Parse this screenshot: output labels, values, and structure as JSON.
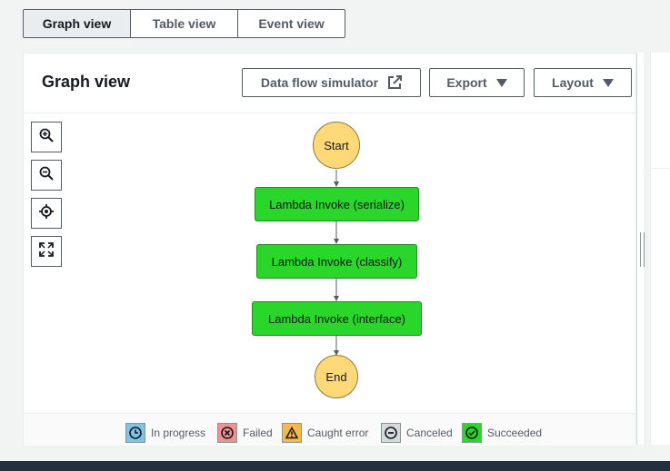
{
  "tabs": [
    {
      "label": "Graph view",
      "active": true
    },
    {
      "label": "Table view",
      "active": false
    },
    {
      "label": "Event view",
      "active": false
    }
  ],
  "panel": {
    "title": "Graph view",
    "buttons": {
      "simulator": {
        "label": "Data flow simulator",
        "icon": "external-link-icon"
      },
      "export": {
        "label": "Export",
        "icon": "caret-down-icon"
      },
      "layout": {
        "label": "Layout",
        "icon": "caret-down-icon"
      }
    }
  },
  "zoom_controls": [
    "zoom-in-icon",
    "zoom-out-icon",
    "center-icon",
    "fit-to-screen-icon"
  ],
  "graph": {
    "start": "Start",
    "states": [
      {
        "label": "Lambda Invoke (serialize)",
        "status": "Succeeded"
      },
      {
        "label": "Lambda Invoke (classify)",
        "status": "Succeeded"
      },
      {
        "label": "Lambda Invoke (interface)",
        "status": "Succeeded"
      }
    ],
    "end": "End"
  },
  "legend": [
    {
      "label": "In progress",
      "color": "#7fc4e6",
      "icon": "clock-icon"
    },
    {
      "label": "Failed",
      "color": "#f19190",
      "icon": "x-circle-icon"
    },
    {
      "label": "Caught error",
      "color": "#f7b84b",
      "icon": "warning-icon"
    },
    {
      "label": "Canceled",
      "color": "#d5dbdb",
      "icon": "minus-circle-icon"
    },
    {
      "label": "Succeeded",
      "color": "#2bd62b",
      "icon": "check-circle-icon"
    }
  ],
  "colors": {
    "node_terminal": "#ffd978",
    "node_success": "#2bd62b",
    "border": "#545b64"
  }
}
